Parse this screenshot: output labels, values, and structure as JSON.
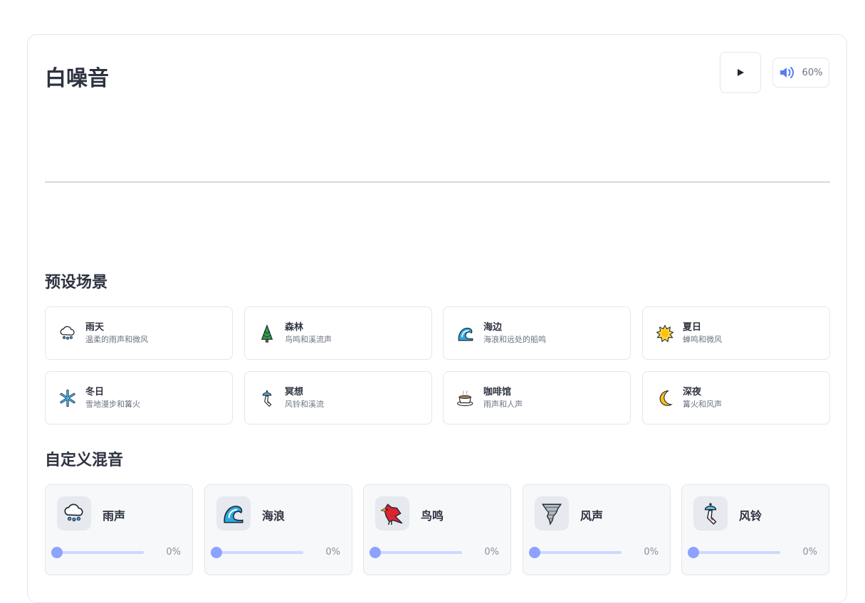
{
  "app": {
    "title": "白噪音",
    "volume_label": "60%",
    "volume_level": 0.6,
    "accent_color": "#8da2ff"
  },
  "presets": {
    "heading": "预设场景",
    "items": [
      {
        "name": "雨天",
        "desc": "温柔的雨声和微风",
        "icon": "rain-cloud-icon"
      },
      {
        "name": "森林",
        "desc": "鸟鸣和溪流声",
        "icon": "pine-tree-icon"
      },
      {
        "name": "海边",
        "desc": "海浪和远处的船鸣",
        "icon": "ocean-wave-icon"
      },
      {
        "name": "夏日",
        "desc": "蝉鸣和微风",
        "icon": "sun-icon"
      },
      {
        "name": "冬日",
        "desc": "雪地漫步和篝火",
        "icon": "snowflake-icon"
      },
      {
        "name": "冥想",
        "desc": "风铃和溪流",
        "icon": "wind-chime-icon"
      },
      {
        "name": "咖啡馆",
        "desc": "雨声和人声",
        "icon": "coffee-icon"
      },
      {
        "name": "深夜",
        "desc": "篝火和风声",
        "icon": "crescent-moon-icon"
      }
    ]
  },
  "mixer": {
    "heading": "自定义混音",
    "channels": [
      {
        "name": "雨声",
        "value_label": "0%",
        "value": 0,
        "icon": "rain-cloud-icon"
      },
      {
        "name": "海浪",
        "value_label": "0%",
        "value": 0,
        "icon": "ocean-wave-icon"
      },
      {
        "name": "鸟鸣",
        "value_label": "0%",
        "value": 0,
        "icon": "cardinal-bird-icon"
      },
      {
        "name": "风声",
        "value_label": "0%",
        "value": 0,
        "icon": "tornado-icon"
      },
      {
        "name": "风铃",
        "value_label": "0%",
        "value": 0,
        "icon": "wind-chime-icon"
      }
    ]
  }
}
